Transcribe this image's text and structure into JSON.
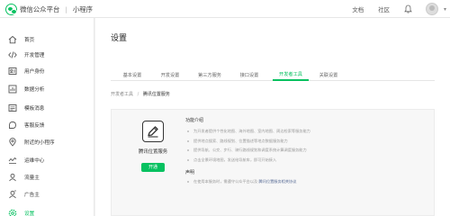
{
  "colors": {
    "accent": "#07c160",
    "link": "#576b95",
    "page_bg": "#f2f2f2",
    "panel_bg": "#f7f7f7"
  },
  "topbar": {
    "brand_logo_icon": "wechat-logo-icon",
    "platform": "微信公众平台",
    "product": "小程序",
    "links": [
      "文档",
      "社区"
    ],
    "bell_icon": "bell-icon",
    "caret": "▾"
  },
  "sidebar": {
    "items": [
      {
        "label": "首页",
        "icon": "home-icon",
        "active": false
      },
      {
        "label": "开发管理",
        "icon": "code-icon",
        "active": false
      },
      {
        "label": "用户身份",
        "icon": "user-icon",
        "active": false
      },
      {
        "label": "数据分析",
        "icon": "chart-icon",
        "active": false
      },
      {
        "label": "模板消息",
        "icon": "message-icon",
        "active": false
      },
      {
        "label": "客服反馈",
        "icon": "service-icon",
        "active": false
      },
      {
        "label": "附近的小程序",
        "icon": "location-icon",
        "active": false
      },
      {
        "label": "运维中心",
        "icon": "ops-icon",
        "active": false
      },
      {
        "label": "流量主",
        "icon": "traffic-icon",
        "active": false
      },
      {
        "label": "广告主",
        "icon": "ads-icon",
        "active": false
      },
      {
        "label": "设置",
        "icon": "settings-icon",
        "active": true
      }
    ]
  },
  "main": {
    "title": "设置",
    "tabs": [
      {
        "label": "基本设置",
        "active": false
      },
      {
        "label": "开发设置",
        "active": false
      },
      {
        "label": "第三方服务",
        "active": false
      },
      {
        "label": "接口设置",
        "active": false
      },
      {
        "label": "开发者工具",
        "active": true
      },
      {
        "label": "关联设置",
        "active": false
      }
    ],
    "breadcrumb": {
      "parent": "开发者工具",
      "separator": "/",
      "current": "腾讯位置服务"
    },
    "plugin": {
      "icon": "edit-pen-icon",
      "name": "腾讯位置服务",
      "button": "开通",
      "features_title": "功能介绍",
      "features": [
        "为开发者提供个性化地图、海外地图、室内地图、周边检索等服务能力",
        "提供地点搜索、路线规划、位置描述等地点数据服务能力",
        "提供导航、公交、步行、骑行路线规划和调度系统计算调度服务能力",
        "点击全景环境地图，发送给导航车，即可开始接入"
      ],
      "statement_title": "声明",
      "statement_text": "在使用本服务时，需遵守公众平台以及",
      "statement_link": "腾讯位置服务相关协议"
    }
  }
}
